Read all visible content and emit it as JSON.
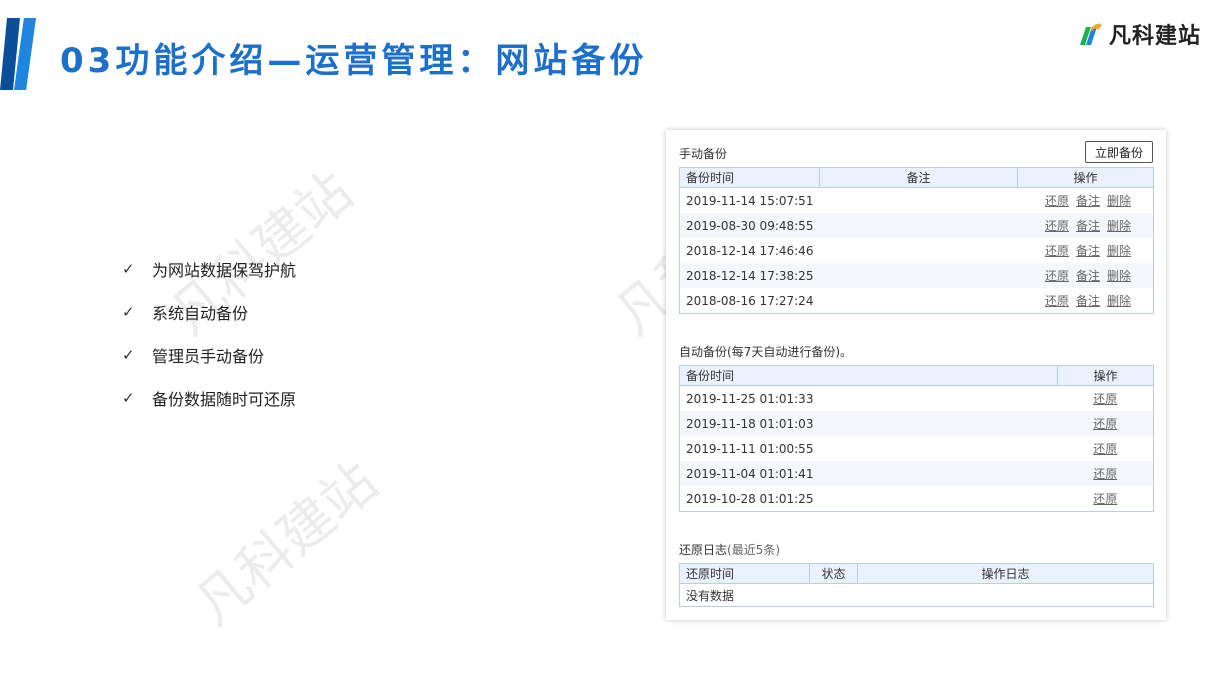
{
  "header": {
    "title": "03功能介绍—运营管理：网站备份",
    "brand": "凡科建站",
    "watermark": "凡科建站"
  },
  "bullets": [
    "为网站数据保驾护航",
    "系统自动备份",
    "管理员手动备份",
    "备份数据随时可还原"
  ],
  "manual": {
    "title": "手动备份",
    "backup_button": "立即备份",
    "columns": [
      "备份时间",
      "备注",
      "操作"
    ],
    "rows": [
      {
        "time": "2019-11-14 15:07:51",
        "note": ""
      },
      {
        "time": "2019-08-30 09:48:55",
        "note": ""
      },
      {
        "time": "2018-12-14 17:46:46",
        "note": ""
      },
      {
        "time": "2018-12-14 17:38:25",
        "note": ""
      },
      {
        "time": "2018-08-16 17:27:24",
        "note": ""
      }
    ],
    "actions": {
      "restore": "还原",
      "note": "备注",
      "delete": "删除"
    }
  },
  "auto": {
    "title": "自动备份(每7天自动进行备份)。",
    "columns": [
      "备份时间",
      "操作"
    ],
    "rows": [
      {
        "time": "2019-11-25 01:01:33"
      },
      {
        "time": "2019-11-18 01:01:03"
      },
      {
        "time": "2019-11-11 01:00:55"
      },
      {
        "time": "2019-11-04 01:01:41"
      },
      {
        "time": "2019-10-28 01:01:25"
      }
    ],
    "restore_label": "还原"
  },
  "log": {
    "title": "还原日志",
    "subtitle": "(最近5条)",
    "columns": [
      "还原时间",
      "状态",
      "操作日志"
    ],
    "empty_text": "没有数据"
  },
  "colors": {
    "title_blue": "#1d6fcc",
    "accent_dark": "#0b4f9a",
    "header_bg": "#e8f1fc"
  }
}
